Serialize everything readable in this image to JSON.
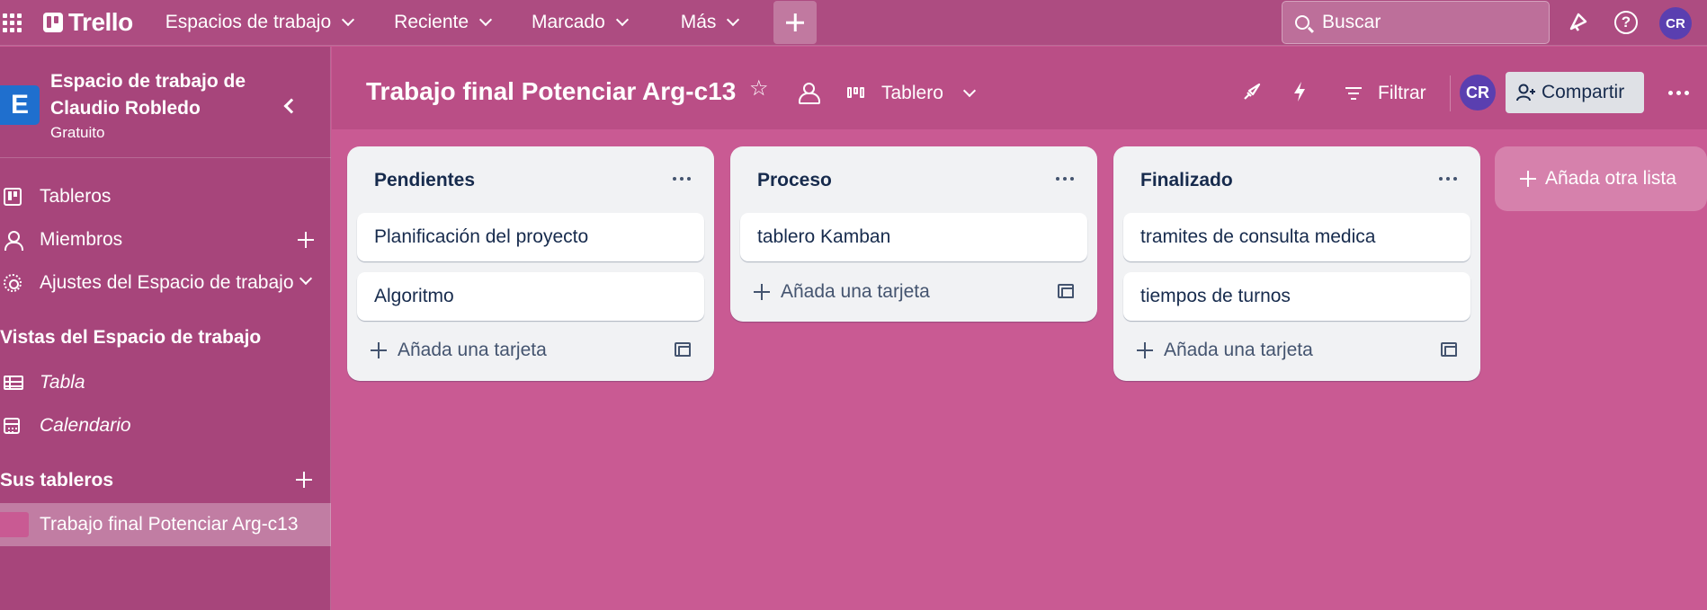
{
  "app": {
    "brand": "Trello"
  },
  "topnav": {
    "items": [
      {
        "label": "Espacios de trabajo"
      },
      {
        "label": "Reciente"
      },
      {
        "label": "Marcado"
      },
      {
        "label": "Más"
      }
    ],
    "search_placeholder": "Buscar",
    "user_initials": "CR"
  },
  "sidebar": {
    "workspace_initial": "E",
    "workspace_name": "Espacio de trabajo de Claudio Robledo",
    "workspace_plan": "Gratuito",
    "items": [
      {
        "label": "Tableros"
      },
      {
        "label": "Miembros"
      },
      {
        "label": "Ajustes del Espacio de trabajo"
      }
    ],
    "views_heading": "Vistas del Espacio de trabajo",
    "views": [
      {
        "label": "Tabla"
      },
      {
        "label": "Calendario"
      }
    ],
    "boards_heading": "Sus tableros",
    "boards": [
      {
        "label": "Trabajo final Potenciar Arg-c13"
      }
    ]
  },
  "board": {
    "title": "Trabajo final Potenciar Arg-c13",
    "view_label": "Tablero",
    "filter_label": "Filtrar",
    "member_initials": "CR",
    "share_label": "Compartir",
    "add_list_label": "Añada otra lista",
    "add_card_label": "Añada una tarjeta",
    "lists": [
      {
        "title": "Pendientes",
        "cards": [
          "Planificación del proyecto",
          "Algoritmo"
        ]
      },
      {
        "title": "Proceso",
        "cards": [
          "tablero Kamban"
        ]
      },
      {
        "title": "Finalizado",
        "cards": [
          "tramites de consulta medica",
          "tiempos de turnos"
        ]
      }
    ]
  },
  "colors": {
    "board_background": "#c95a93",
    "topbar": "#ad4c81",
    "sidebar": "#a7457b",
    "list_background": "#f1f2f4",
    "workspace_avatar": "#1f6fce",
    "user_avatar": "#5a3fb0"
  }
}
